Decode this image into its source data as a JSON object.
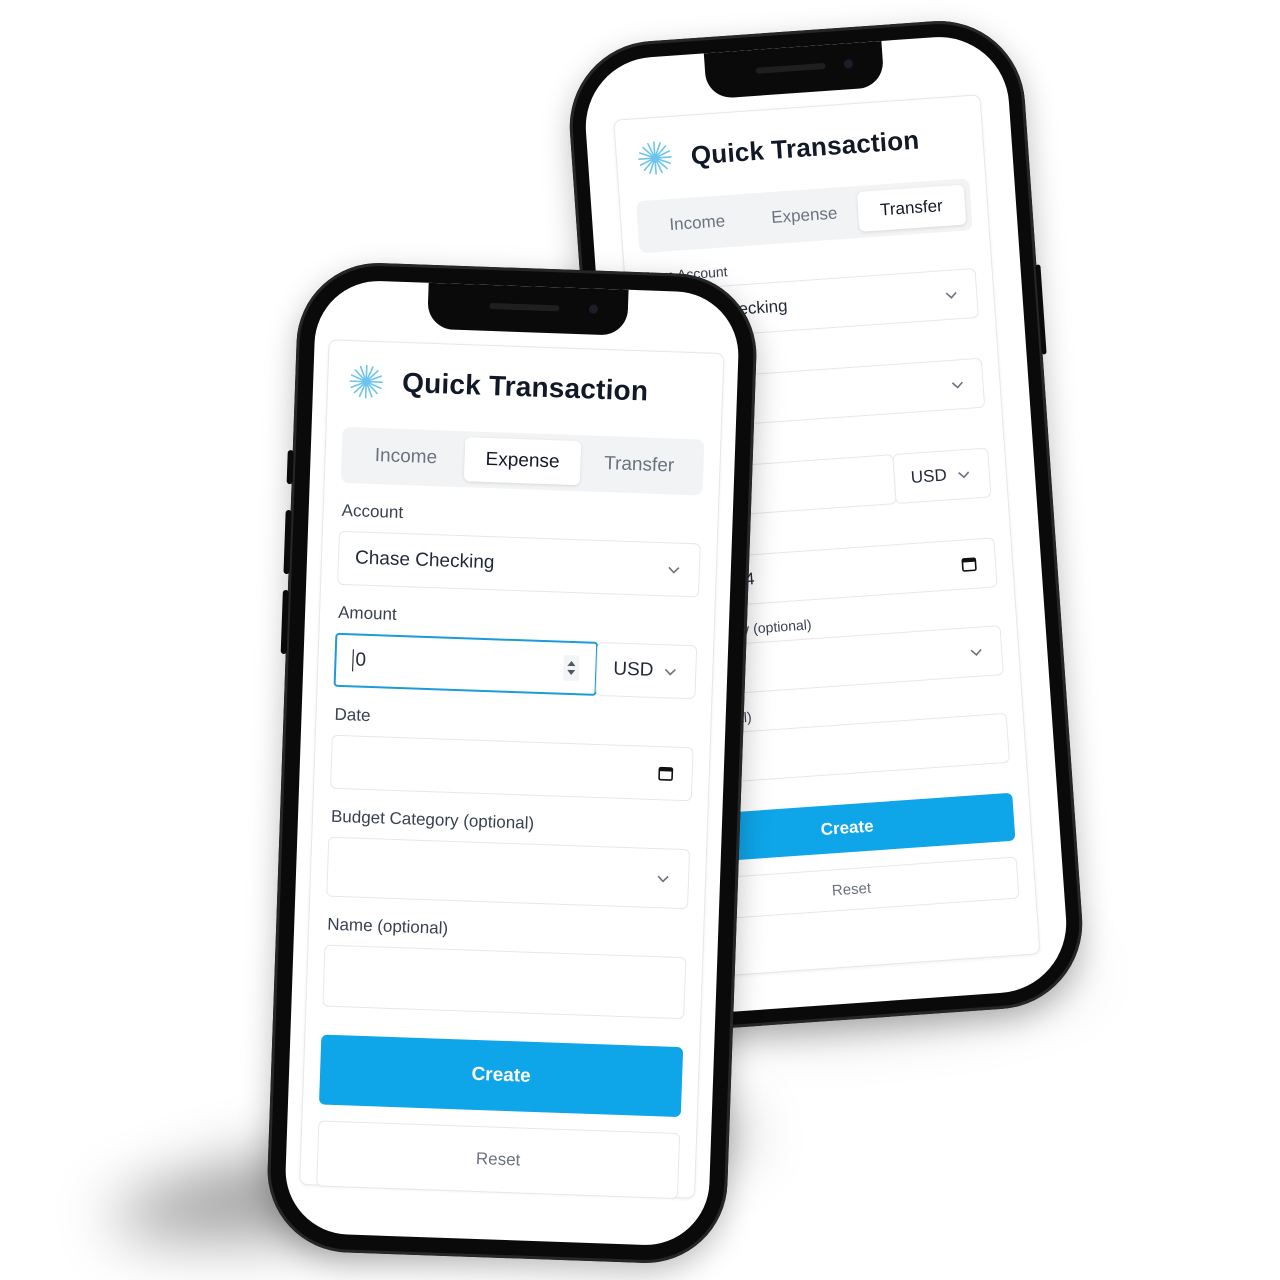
{
  "colors": {
    "accent": "#0ea5e9",
    "focus": "#1d9bd8",
    "title": "#111827",
    "muted": "#6b7280",
    "border": "#e5e7eb"
  },
  "front": {
    "title": "Quick Transaction",
    "tabs": [
      {
        "label": "Income",
        "active": false
      },
      {
        "label": "Expense",
        "active": true
      },
      {
        "label": "Transfer",
        "active": false
      }
    ],
    "account": {
      "label": "Account",
      "value": "Chase Checking"
    },
    "amount": {
      "label": "Amount",
      "value": "0",
      "currency": "USD"
    },
    "date": {
      "label": "Date",
      "value": ""
    },
    "budget_category": {
      "label": "Budget Category (optional)",
      "value": ""
    },
    "name": {
      "label": "Name (optional)",
      "value": ""
    },
    "create_label": "Create",
    "reset_label": "Reset"
  },
  "back": {
    "title": "Quick Transaction",
    "tabs": [
      {
        "label": "Income",
        "active": false
      },
      {
        "label": "Expense",
        "active": false
      },
      {
        "label": "Transfer",
        "active": true
      }
    ],
    "from_account": {
      "label": "From Account",
      "value": "Checking"
    },
    "currency": "USD",
    "date_fragment": "24",
    "category_fragment": "gory (optional)",
    "name_fragment": "nal)",
    "create_label": "Create",
    "reset_label": "Reset"
  }
}
